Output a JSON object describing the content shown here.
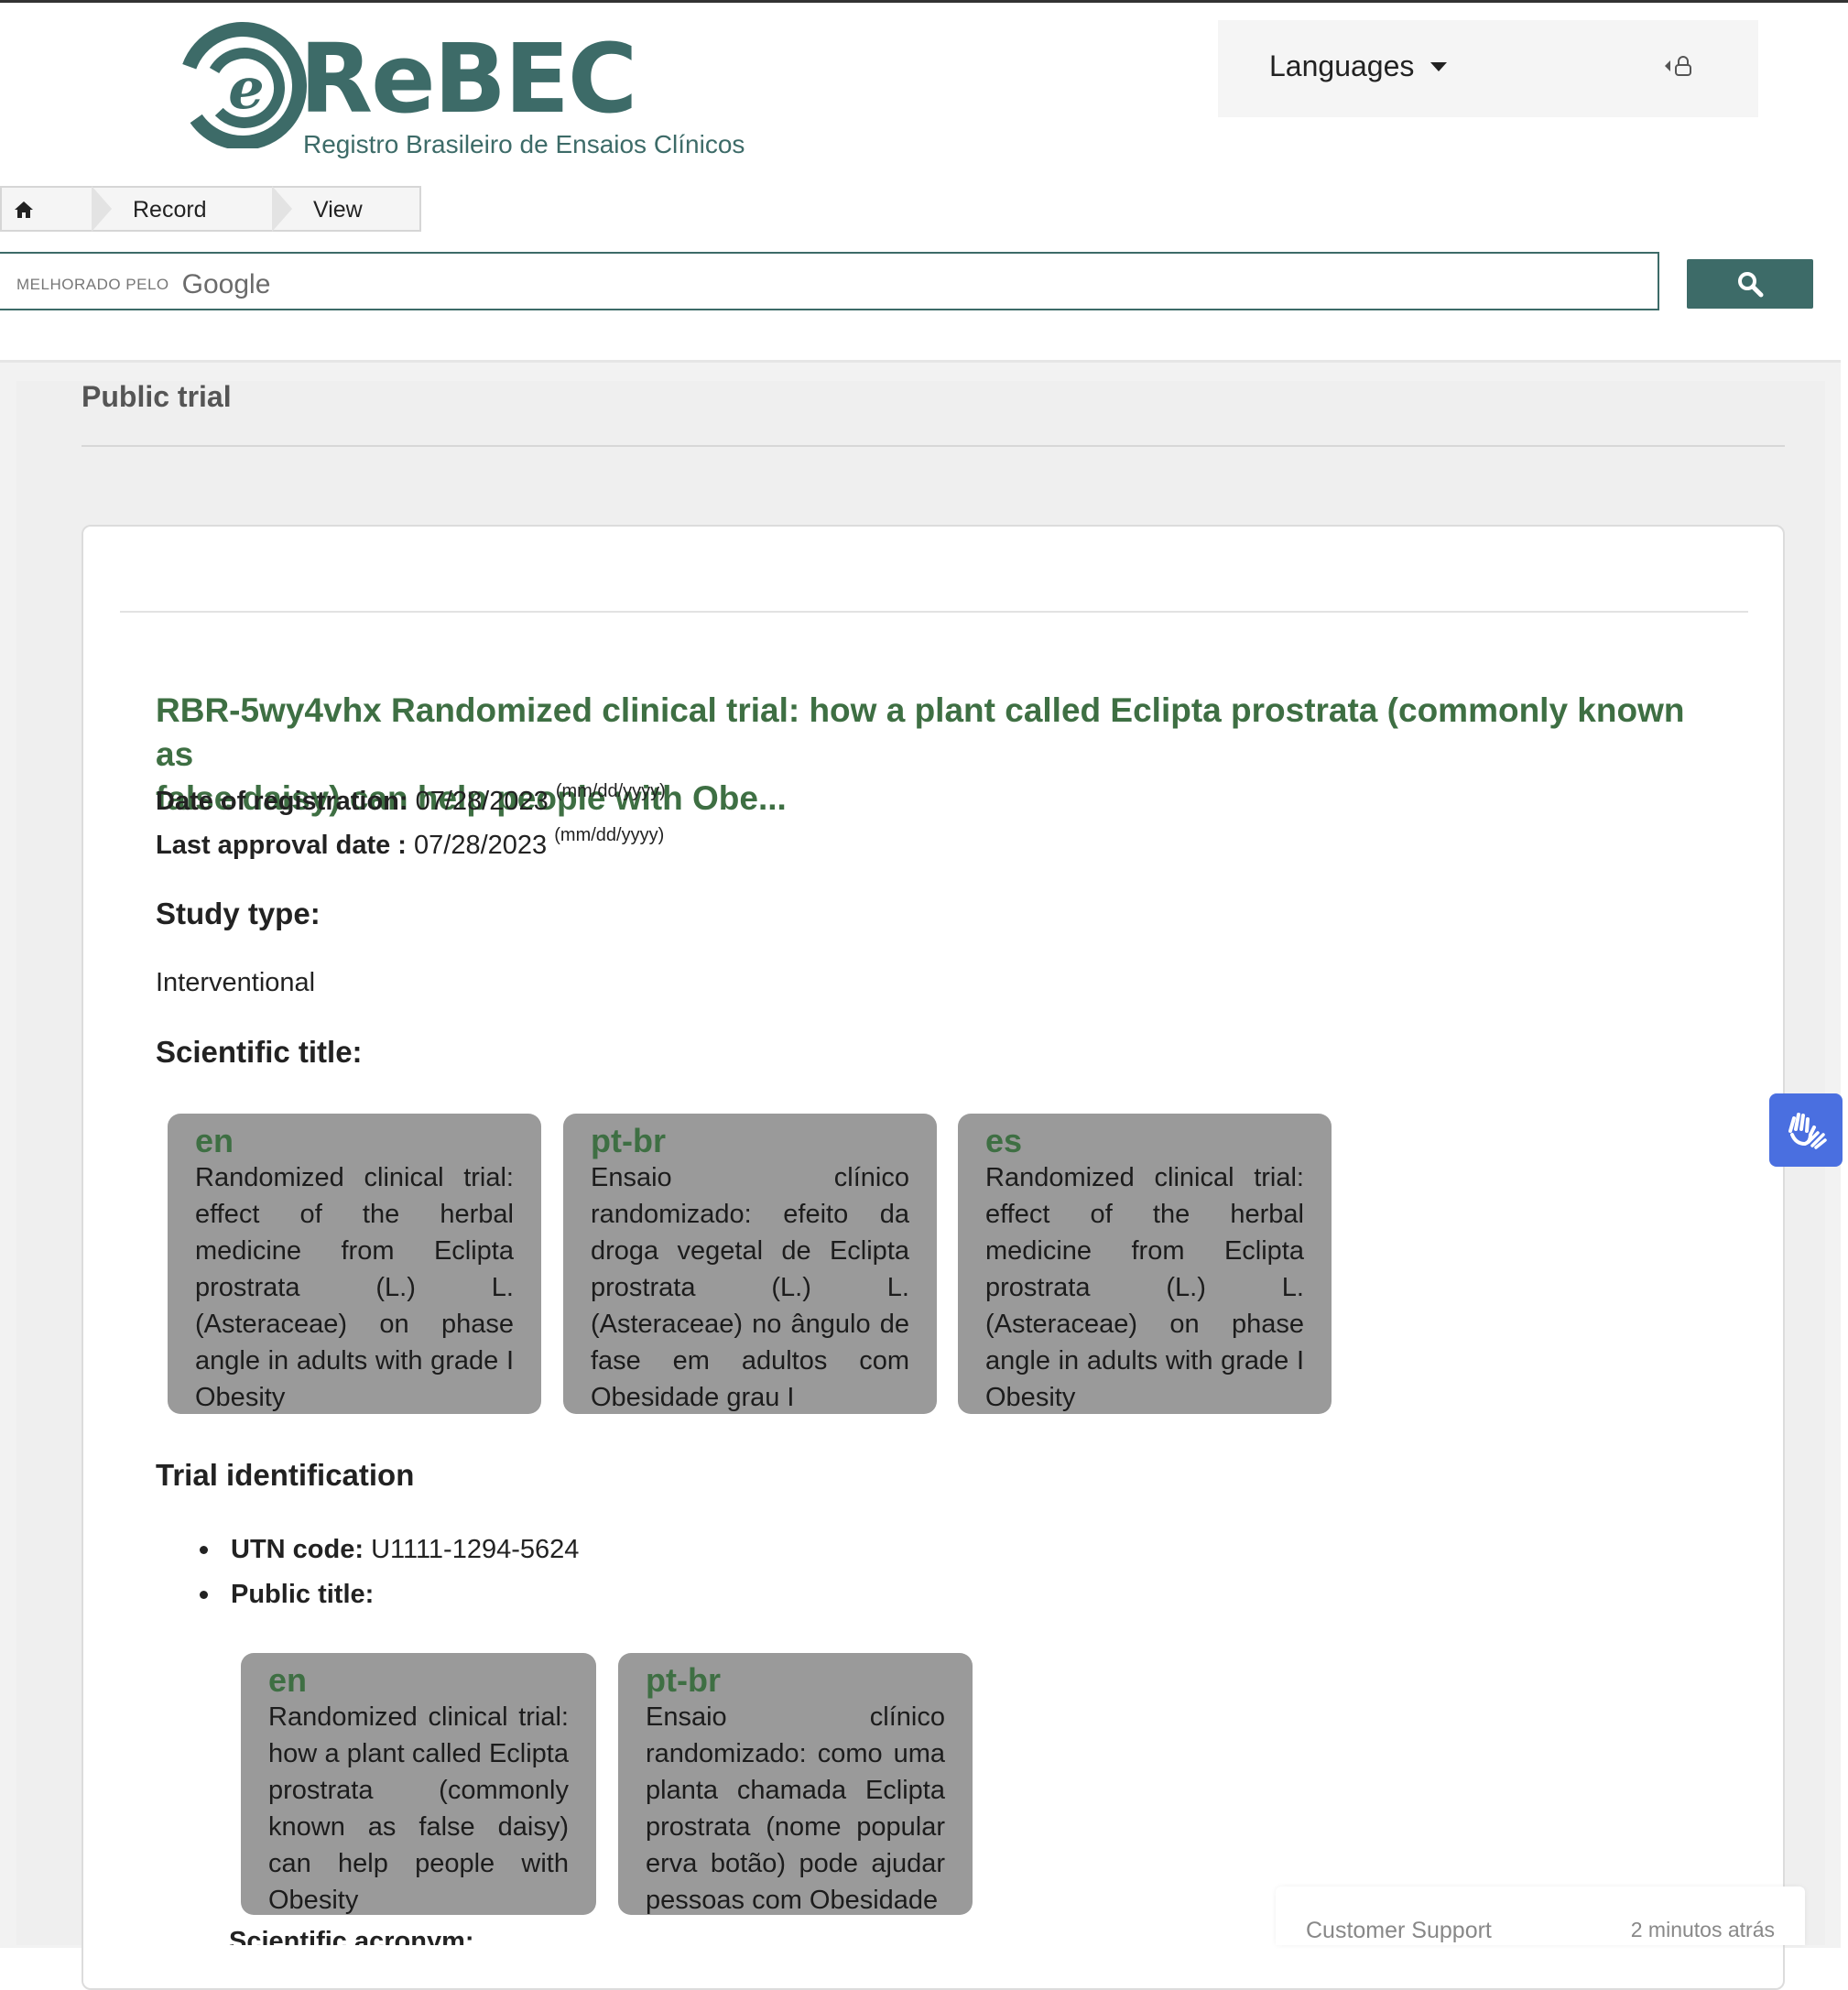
{
  "logo": {
    "wordmark": "ReBEC",
    "subtitle": "Registro Brasileiro de Ensaios Clínicos",
    "brand_color": "#3d6b68"
  },
  "header": {
    "languages_label": "Languages",
    "login_icon": "user-lock-icon"
  },
  "breadcrumb": {
    "home_icon": "home-icon",
    "items": [
      "Record",
      "View"
    ]
  },
  "search": {
    "brand_small": "MELHORADO PELO",
    "brand_google": "Google",
    "button_icon": "search-icon",
    "accent": "#3d6b68"
  },
  "page": {
    "title": "Public trial"
  },
  "trial": {
    "heading_line1": "RBR-5wy4vhx Randomized clinical trial: how a plant called Eclipta prostrata (commonly known as",
    "heading_line2": "false daisy) can help people with Obe...",
    "heading_color": "#3e6f43",
    "registration_label": "Date of registration:",
    "registration_value": "07/28/2023",
    "registration_format": "(mm/dd/yyyy)",
    "approval_label": "Last approval date :",
    "approval_value": "07/28/2023",
    "approval_format": "(mm/dd/yyyy)",
    "study_type_heading": "Study type:",
    "study_type_value": "Interventional",
    "scientific_title_heading": "Scientific title:",
    "scientific_titles": [
      {
        "code": "en",
        "text": "Randomized clinical trial: effect of the herbal medicine from Eclipta prostrata (L.) L. (Asteraceae) on phase angle in adults with grade I Obesity"
      },
      {
        "code": "pt-br",
        "text": "Ensaio clínico randomizado: efeito da droga vegetal de Eclipta prostrata (L.) L. (Asteraceae) no ângulo de fase em adultos com Obesidade grau I"
      },
      {
        "code": "es",
        "text": "Randomized clinical trial: effect of the herbal medicine from Eclipta prostrata (L.) L. (Asteraceae) on phase angle in adults with grade I Obesity"
      }
    ],
    "identification_heading": "Trial identification",
    "utn_label": "UTN code:",
    "utn_value": "U1111-1294-5624",
    "public_title_label": "Public title:",
    "public_titles": [
      {
        "code": "en",
        "text": "Randomized clinical trial: how a plant called Eclipta prostrata (commonly known as false daisy) can help people with Obesity"
      },
      {
        "code": "pt-br",
        "text": "Ensaio clínico randomizado: como uma planta chamada Eclipta prostrata (nome popular erva botão) pode ajudar pessoas com Obesidade"
      }
    ],
    "next_section_label": "Scientific acronym:"
  },
  "accessibility": {
    "icon": "sign-language-hands-icon",
    "color": "#4a6fe0"
  },
  "support": {
    "name": "Customer Support",
    "time": "2 minutos atrás"
  }
}
